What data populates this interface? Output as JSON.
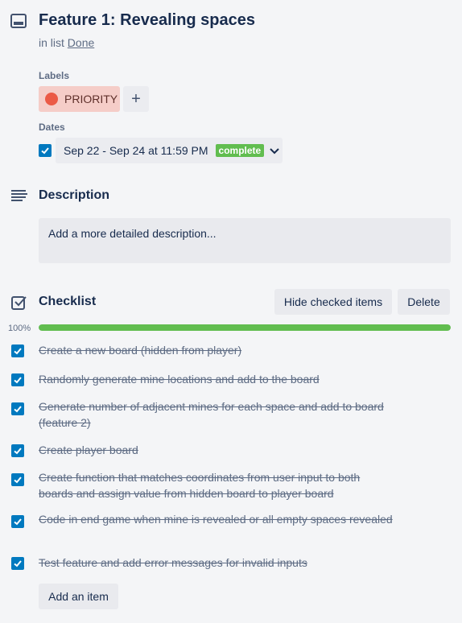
{
  "card": {
    "title": "Feature 1: Revealing spaces",
    "in_list_prefix": "in list",
    "list_name": "Done"
  },
  "labels": {
    "heading": "Labels",
    "items": [
      {
        "text": "PRIORITY",
        "color": "#eb5a46",
        "bg": "#f5cdc8"
      }
    ],
    "add_symbol": "+"
  },
  "dates": {
    "heading": "Dates",
    "checked": true,
    "range": "Sep 22 - Sep 24 at 11:59 PM",
    "status": "complete"
  },
  "description": {
    "heading": "Description",
    "placeholder": "Add a more detailed description..."
  },
  "checklist": {
    "heading": "Checklist",
    "hide_label": "Hide checked items",
    "delete_label": "Delete",
    "progress_text": "100%",
    "progress": 1.0,
    "items": [
      {
        "text": "Create a new board (hidden from player)",
        "checked": true
      },
      {
        "text": "Randomly generate mine locations and add to the board",
        "checked": true
      },
      {
        "text": "Generate number of adjacent mines for each space and add to board (feature 2)",
        "checked": true
      },
      {
        "text": "Create player board",
        "checked": true
      },
      {
        "text": "Create function that matches coordinates from user input to both boards and assign value from hidden board to player board",
        "checked": true
      },
      {
        "text": "Code in end game when mine is revealed or all empty spaces revealed",
        "checked": true
      },
      {
        "text": "Test feature and add error messages for invalid inputs",
        "checked": true
      }
    ],
    "add_item_label": "Add an item"
  },
  "colors": {
    "accent_blue": "#0079bf",
    "success_green": "#61bd4f",
    "text_dark": "#172b4d",
    "text_muted": "#5e6c84"
  },
  "icons": [
    "card-icon",
    "description-icon",
    "checklist-icon",
    "check-icon",
    "chevron-down-icon",
    "plus-icon"
  ]
}
